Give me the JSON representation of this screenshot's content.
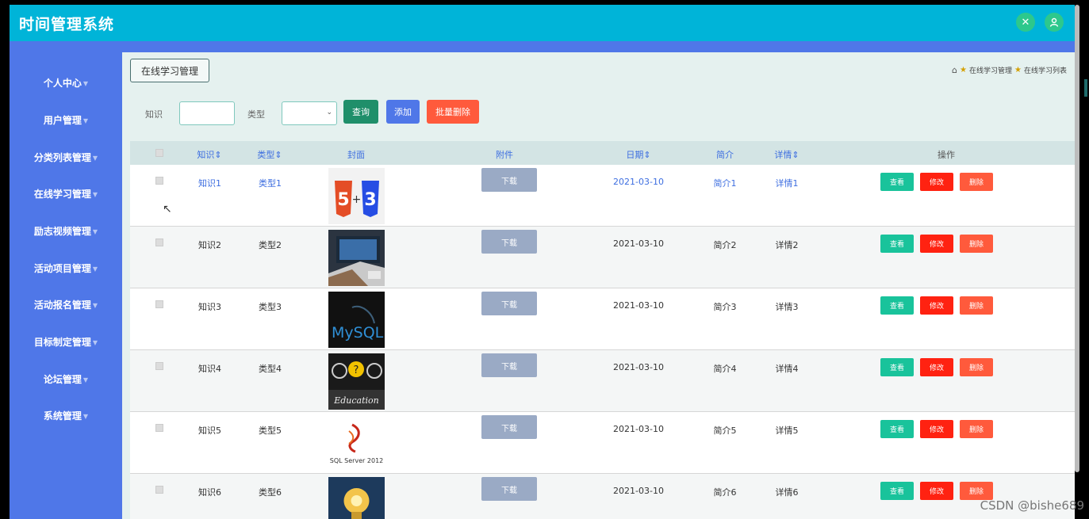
{
  "app": {
    "title": "时间管理系统"
  },
  "header": {
    "icons": [
      "expand-icon",
      "user-icon"
    ]
  },
  "sidebar": {
    "items": [
      {
        "label": "个人中心"
      },
      {
        "label": "用户管理"
      },
      {
        "label": "分类列表管理"
      },
      {
        "label": "在线学习管理"
      },
      {
        "label": "励志视频管理"
      },
      {
        "label": "活动项目管理"
      },
      {
        "label": "活动报名管理"
      },
      {
        "label": "目标制定管理"
      },
      {
        "label": "论坛管理"
      },
      {
        "label": "系统管理"
      }
    ]
  },
  "content": {
    "tab_label": "在线学习管理",
    "breadcrumb": [
      "在线学习管理",
      "在线学习列表"
    ]
  },
  "search": {
    "label_knowledge": "知识",
    "knowledge_value": "",
    "label_type": "类型",
    "type_value": "",
    "query_button": "查询",
    "add_button": "添加",
    "batch_delete_button": "批量删除"
  },
  "table": {
    "headers": {
      "knowledge": "知识",
      "type": "类型",
      "cover": "封面",
      "attachment": "附件",
      "date": "日期",
      "summary": "简介",
      "details": "详情",
      "actions": "操作"
    },
    "download_label": "下载",
    "view_label": "查看",
    "edit_label": "修改",
    "delete_label": "删除",
    "rows": [
      {
        "knowledge": "知识1",
        "type": "类型1",
        "date": "2021-03-10",
        "summary": "简介1",
        "details": "详情1",
        "cover": "html5-css3"
      },
      {
        "knowledge": "知识2",
        "type": "类型2",
        "date": "2021-03-10",
        "summary": "简介2",
        "details": "详情2",
        "cover": "laptop"
      },
      {
        "knowledge": "知识3",
        "type": "类型3",
        "date": "2021-03-10",
        "summary": "简介3",
        "details": "详情3",
        "cover": "MySQL"
      },
      {
        "knowledge": "知识4",
        "type": "类型4",
        "date": "2021-03-10",
        "summary": "简介4",
        "details": "详情4",
        "cover": "Education"
      },
      {
        "knowledge": "知识5",
        "type": "类型5",
        "date": "2021-03-10",
        "summary": "简介5",
        "details": "详情5",
        "cover": "SQL Server 2012"
      },
      {
        "knowledge": "知识6",
        "type": "类型6",
        "date": "2021-03-10",
        "summary": "简介6",
        "details": "详情6",
        "cover": "lightbulb"
      }
    ]
  },
  "watermark": "CSDN @bishe689",
  "colors": {
    "header": "#00b4d8",
    "sidebar": "#4f77e8",
    "content_bg": "#e5f1ef",
    "view": "#19c39b",
    "edit": "#ff2211",
    "delete": "#ff5a3c",
    "query": "#1f8f6a",
    "add": "#4f77e8",
    "batch_delete": "#ff5a3c"
  }
}
